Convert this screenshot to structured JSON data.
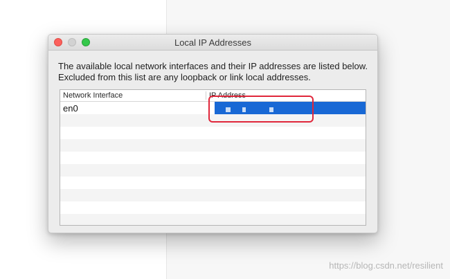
{
  "window": {
    "title": "Local IP Addresses",
    "description": "The available local network interfaces and their IP addresses are listed below.  Excluded from this list are any loopback or link local addresses."
  },
  "table": {
    "columns": [
      "Network Interface",
      "IP Address"
    ],
    "rows": [
      {
        "interface": "en0",
        "ip": ""
      }
    ]
  },
  "watermark": "https://blog.csdn.net/resilient",
  "colors": {
    "selection": "#1868d5",
    "annotation": "#e0263a"
  }
}
